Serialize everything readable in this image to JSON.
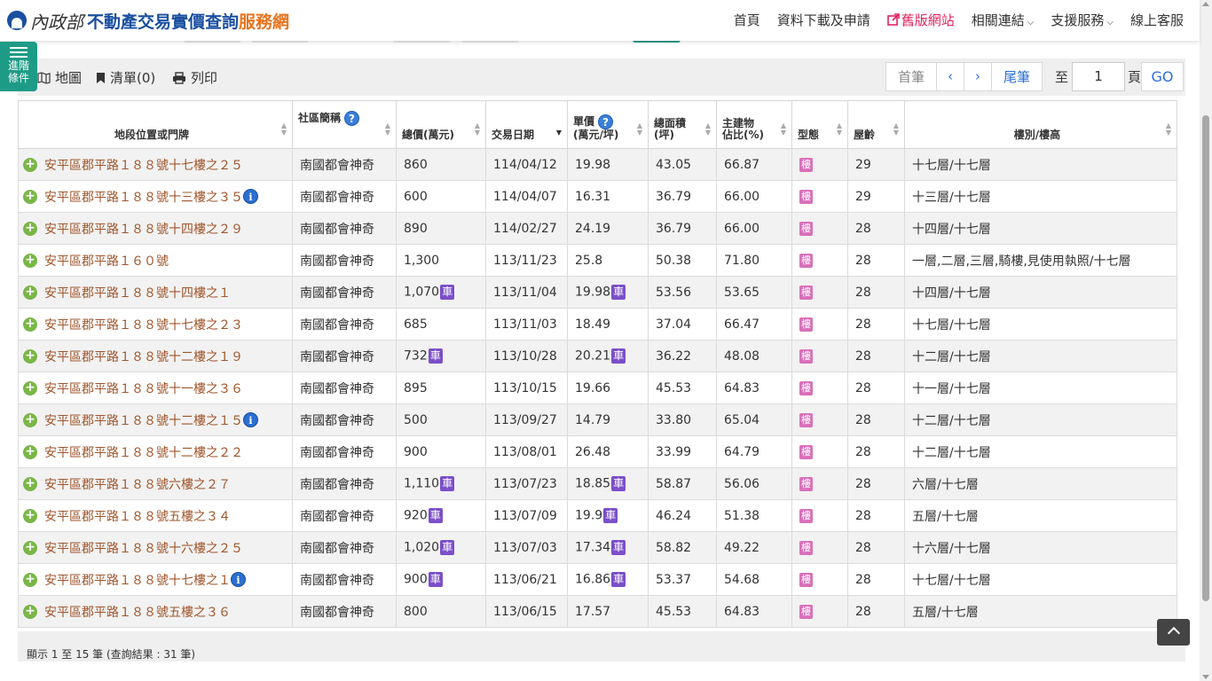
{
  "header": {
    "ministry": "內政部",
    "title_main": "不動產交易實價查詢",
    "title_accent": "服務網",
    "nav": [
      {
        "label": "首頁"
      },
      {
        "label": "資料下載及申請"
      },
      {
        "label": "舊版網站",
        "icon": "external-link-icon"
      },
      {
        "label": "相關連結",
        "dropdown": true
      },
      {
        "label": "支援服務",
        "dropdown": true
      },
      {
        "label": "線上客服"
      }
    ]
  },
  "side_tab": {
    "line1": "進階",
    "line2": "條件",
    "icon": "sliders-icon"
  },
  "toolbar": {
    "map": "地圖",
    "list": "清單(0)",
    "print": "列印",
    "first": "首筆",
    "prev": "‹",
    "next": "›",
    "last": "尾筆",
    "to": "至",
    "page_value": "1",
    "page": "頁",
    "go": "GO"
  },
  "table": {
    "headers": {
      "location": "地段位置或門牌",
      "community": "社區簡稱",
      "total": "總價(萬元)",
      "date": "交易日期",
      "unit_l1": "單價",
      "unit_l2": "(萬元/坪)",
      "area_l1": "總面積",
      "area_l2": "(坪)",
      "main_l1": "主建物",
      "main_l2": "佔比(%)",
      "type": "型態",
      "age": "屋齡",
      "floor": "樓別/樓高"
    },
    "car_label": "車",
    "type_label": "樓",
    "info_label": "i",
    "rows": [
      {
        "addr": "安平區郡平路１８８號十七樓之２５",
        "info": false,
        "community": "南國都會神奇",
        "total": "860",
        "total_car": false,
        "date": "114/04/12",
        "unit": "19.98",
        "unit_car": false,
        "area": "43.05",
        "main": "66.87",
        "age": "29",
        "floor": "十七層/十七層"
      },
      {
        "addr": "安平區郡平路１８８號十三樓之３５",
        "info": true,
        "community": "南國都會神奇",
        "total": "600",
        "total_car": false,
        "date": "114/04/07",
        "unit": "16.31",
        "unit_car": false,
        "area": "36.79",
        "main": "66.00",
        "age": "29",
        "floor": "十三層/十七層"
      },
      {
        "addr": "安平區郡平路１８８號十四樓之２９",
        "info": false,
        "community": "南國都會神奇",
        "total": "890",
        "total_car": false,
        "date": "114/02/27",
        "unit": "24.19",
        "unit_car": false,
        "area": "36.79",
        "main": "66.00",
        "age": "28",
        "floor": "十四層/十七層"
      },
      {
        "addr": "安平區郡平路１６０號",
        "info": false,
        "community": "南國都會神奇",
        "total": "1,300",
        "total_car": false,
        "date": "113/11/23",
        "unit": "25.8",
        "unit_car": false,
        "area": "50.38",
        "main": "71.80",
        "age": "28",
        "floor": "一層,二層,三層,騎樓,見使用執照/十七層"
      },
      {
        "addr": "安平區郡平路１８８號十四樓之１",
        "info": false,
        "community": "南國都會神奇",
        "total": "1,070",
        "total_car": true,
        "date": "113/11/04",
        "unit": "19.98",
        "unit_car": true,
        "area": "53.56",
        "main": "53.65",
        "age": "28",
        "floor": "十四層/十七層"
      },
      {
        "addr": "安平區郡平路１８８號十七樓之２３",
        "info": false,
        "community": "南國都會神奇",
        "total": "685",
        "total_car": false,
        "date": "113/11/03",
        "unit": "18.49",
        "unit_car": false,
        "area": "37.04",
        "main": "66.47",
        "age": "28",
        "floor": "十七層/十七層"
      },
      {
        "addr": "安平區郡平路１８８號十二樓之１９",
        "info": false,
        "community": "南國都會神奇",
        "total": "732",
        "total_car": true,
        "date": "113/10/28",
        "unit": "20.21",
        "unit_car": true,
        "area": "36.22",
        "main": "48.08",
        "age": "28",
        "floor": "十二層/十七層"
      },
      {
        "addr": "安平區郡平路１８８號十一樓之３６",
        "info": false,
        "community": "南國都會神奇",
        "total": "895",
        "total_car": false,
        "date": "113/10/15",
        "unit": "19.66",
        "unit_car": false,
        "area": "45.53",
        "main": "64.83",
        "age": "28",
        "floor": "十一層/十七層"
      },
      {
        "addr": "安平區郡平路１８８號十二樓之１５",
        "info": true,
        "community": "南國都會神奇",
        "total": "500",
        "total_car": false,
        "date": "113/09/27",
        "unit": "14.79",
        "unit_car": false,
        "area": "33.80",
        "main": "65.04",
        "age": "28",
        "floor": "十二層/十七層"
      },
      {
        "addr": "安平區郡平路１８８號十二樓之２２",
        "info": false,
        "community": "南國都會神奇",
        "total": "900",
        "total_car": false,
        "date": "113/08/01",
        "unit": "26.48",
        "unit_car": false,
        "area": "33.99",
        "main": "64.79",
        "age": "28",
        "floor": "十二層/十七層"
      },
      {
        "addr": "安平區郡平路１８８號六樓之２７",
        "info": false,
        "community": "南國都會神奇",
        "total": "1,110",
        "total_car": true,
        "date": "113/07/23",
        "unit": "18.85",
        "unit_car": true,
        "area": "58.87",
        "main": "56.06",
        "age": "28",
        "floor": "六層/十七層"
      },
      {
        "addr": "安平區郡平路１８８號五樓之３４",
        "info": false,
        "community": "南國都會神奇",
        "total": "920",
        "total_car": true,
        "date": "113/07/09",
        "unit": "19.9",
        "unit_car": true,
        "area": "46.24",
        "main": "51.38",
        "age": "28",
        "floor": "五層/十七層"
      },
      {
        "addr": "安平區郡平路１８８號十六樓之２５",
        "info": false,
        "community": "南國都會神奇",
        "total": "1,020",
        "total_car": true,
        "date": "113/07/03",
        "unit": "17.34",
        "unit_car": true,
        "area": "58.82",
        "main": "49.22",
        "age": "28",
        "floor": "十六層/十七層"
      },
      {
        "addr": "安平區郡平路１８８號十七樓之１",
        "info": true,
        "community": "南國都會神奇",
        "total": "900",
        "total_car": true,
        "date": "113/06/21",
        "unit": "16.86",
        "unit_car": true,
        "area": "53.37",
        "main": "54.68",
        "age": "28",
        "floor": "十七層/十七層"
      },
      {
        "addr": "安平區郡平路１８８號五樓之３６",
        "info": false,
        "community": "南國都會神奇",
        "total": "800",
        "total_car": false,
        "date": "113/06/15",
        "unit": "17.57",
        "unit_car": false,
        "area": "45.53",
        "main": "64.83",
        "age": "28",
        "floor": "五層/十七層"
      }
    ]
  },
  "footer": {
    "summary": "顯示 1 至 15 筆 (查詢結果 : 31 筆)"
  },
  "colors": {
    "accent_blue": "#1a4fa0",
    "accent_orange": "#e8741d",
    "side_tab": "#1e9b86",
    "address": "#a0552a",
    "car_badge": "#7b4fc9",
    "type_badge": "#d970b8"
  }
}
